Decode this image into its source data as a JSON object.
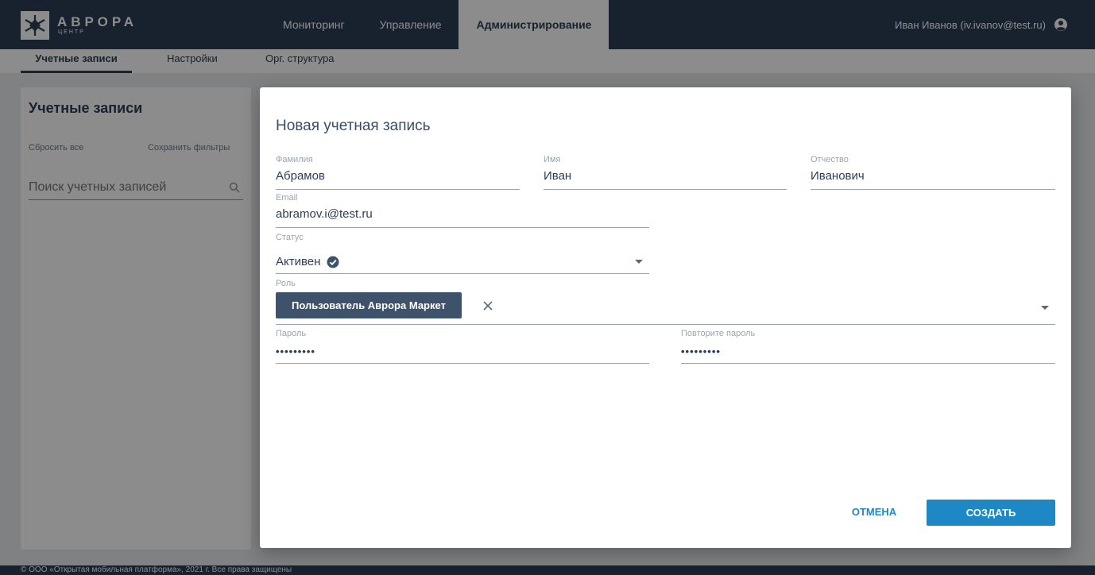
{
  "app": {
    "logo_name": "АВРОРА",
    "logo_sub": "ЦЕНТР"
  },
  "topnav": [
    {
      "label": "Мониторинг",
      "active": false
    },
    {
      "label": "Управление",
      "active": false
    },
    {
      "label": "Администрирование",
      "active": true
    }
  ],
  "user": {
    "label": "Иван Иванов (iv.ivanov@test.ru)",
    "icon": "account-circle-icon"
  },
  "subnav": [
    {
      "label": "Учетные записи",
      "active": true
    },
    {
      "label": "Настройки",
      "active": false
    },
    {
      "label": "Орг. структура",
      "active": false
    }
  ],
  "left_panel": {
    "title": "Учетные записи",
    "reset_label": "Сбросить все",
    "save_filters_label": "Сохранить фильтры",
    "search_placeholder": "Поиск учетных записей",
    "search_icon": "search-icon"
  },
  "footer": {
    "text": "© ООО «Открытая мобильная платформа», 2021 г. Все права защищены"
  },
  "modal": {
    "title": "Новая учетная запись",
    "last_name": {
      "label": "Фамилия",
      "value": "Абрамов"
    },
    "first_name": {
      "label": "Имя",
      "value": "Иван"
    },
    "middle_name": {
      "label": "Отчество",
      "value": "Иванович"
    },
    "email": {
      "label": "Email",
      "value": "abramov.i@test.ru"
    },
    "status": {
      "label": "Статус",
      "value": "Активен",
      "icon": "check-circle-icon"
    },
    "role": {
      "label": "Роль",
      "chip": "Пользователь Аврора Маркет",
      "chip_close_icon": "close-icon"
    },
    "password": {
      "label": "Пароль",
      "value": "•••••••••"
    },
    "password_repeat": {
      "label": "Повторите пароль",
      "value": "•••••••••"
    },
    "cancel_label": "ОТМЕНА",
    "create_label": "СОЗДАТЬ"
  },
  "colors": {
    "nav_bg": "#2c3e57",
    "accent": "#1e88c7",
    "chip_bg": "#3f526c"
  }
}
